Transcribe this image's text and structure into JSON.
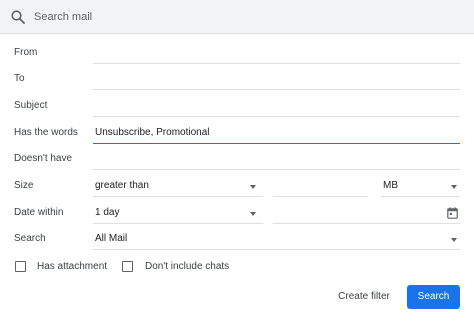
{
  "search": {
    "placeholder": "Search mail",
    "value": ""
  },
  "fields": {
    "from": {
      "label": "From",
      "value": ""
    },
    "to": {
      "label": "To",
      "value": ""
    },
    "subject": {
      "label": "Subject",
      "value": ""
    },
    "has_words": {
      "label": "Has the words",
      "value": "Unsubscribe, Promotional"
    },
    "doesnt_have": {
      "label": "Doesn't have",
      "value": ""
    },
    "size": {
      "label": "Size",
      "operator": "greater than",
      "amount": "",
      "unit": "MB"
    },
    "date_within": {
      "label": "Date within",
      "range": "1 day",
      "date": ""
    },
    "search_in": {
      "label": "Search",
      "value": "All Mail"
    }
  },
  "options": {
    "has_attachment": {
      "label": "Has attachment",
      "checked": false
    },
    "dont_include_chats": {
      "label": "Don't include chats",
      "checked": false
    }
  },
  "actions": {
    "create_filter": "Create filter",
    "search": "Search"
  },
  "colors": {
    "accent": "#1a73e8",
    "search_bar_bg": "#f1f3f4",
    "divider": "#e0e0e0"
  },
  "icons": {
    "search": "search-icon",
    "calendar": "calendar-icon",
    "dropdown": "caret-down-icon"
  }
}
